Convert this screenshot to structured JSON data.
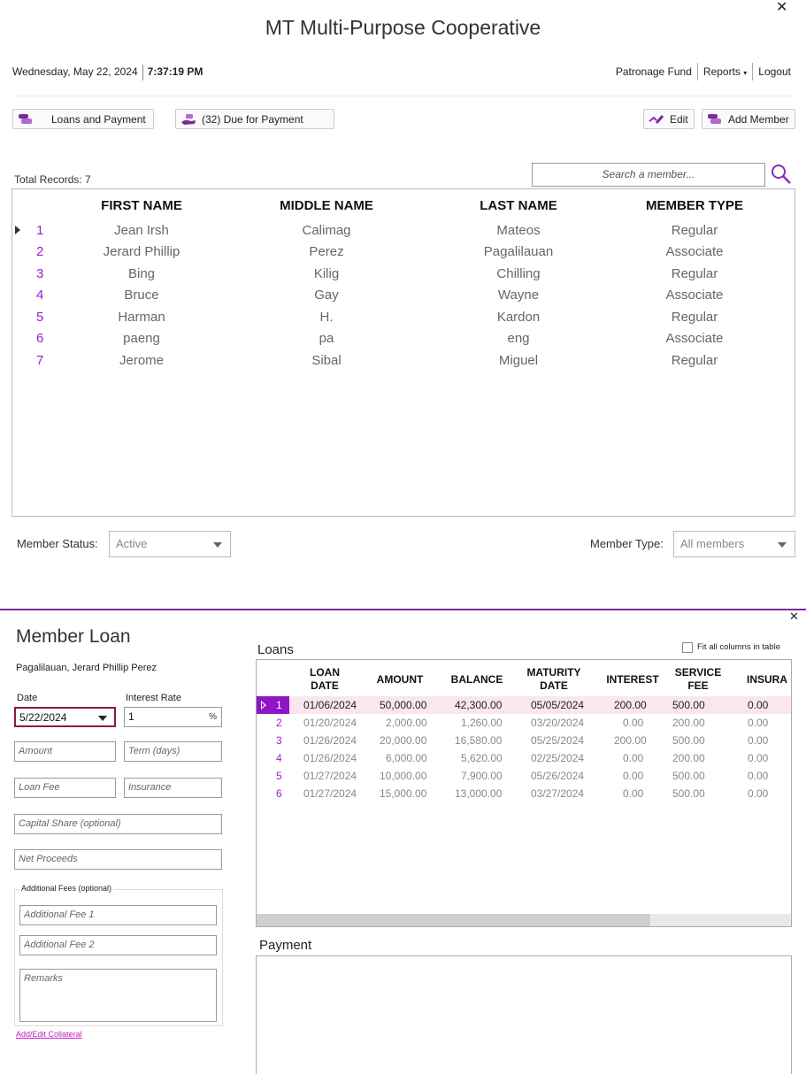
{
  "top_window": {
    "close_icon": "close-icon",
    "title": "MT Multi-Purpose Cooperative",
    "date": "Wednesday, May 22, 2024",
    "time": "7:37:19 PM",
    "nav": {
      "patronage": "Patronage Fund",
      "reports": "Reports",
      "logout": "Logout"
    },
    "toolbar": {
      "loans_payment": "Loans and Payment",
      "due_payment": "(32) Due for Payment",
      "edit": "Edit",
      "add_member": "Add Member"
    },
    "total_records": "Total Records: 7",
    "search_placeholder": "Search a member...",
    "columns": [
      "FIRST NAME",
      "MIDDLE NAME",
      "LAST NAME",
      "MEMBER TYPE"
    ],
    "rows": [
      {
        "num": "1",
        "first": "Jean Irsh",
        "middle": "Calimag",
        "last": "Mateos",
        "type": "Regular"
      },
      {
        "num": "2",
        "first": "Jerard Phillip",
        "middle": "Perez",
        "last": "Pagalilauan",
        "type": "Associate"
      },
      {
        "num": "3",
        "first": "Bing",
        "middle": "Kilig",
        "last": "Chilling",
        "type": "Regular"
      },
      {
        "num": "4",
        "first": "Bruce",
        "middle": "Gay",
        "last": "Wayne",
        "type": "Associate"
      },
      {
        "num": "5",
        "first": "Harman",
        "middle": "H.",
        "last": "Kardon",
        "type": "Regular"
      },
      {
        "num": "6",
        "first": "paeng",
        "middle": "pa",
        "last": "eng",
        "type": "Associate"
      },
      {
        "num": "7",
        "first": "Jerome",
        "middle": "Sibal",
        "last": "Miguel",
        "type": "Regular"
      }
    ],
    "member_status_label": "Member Status:",
    "member_status_value": "Active",
    "member_type_label": "Member Type:",
    "member_type_value": "All members"
  },
  "bottom_window": {
    "title": "Member Loan",
    "member_name": "Pagalilauan, Jerard Phillip Perez",
    "date_label": "Date",
    "date_value": "5/22/2024",
    "interest_label": "Interest Rate",
    "interest_value": "1",
    "percent": "%",
    "amount_ph": "Amount",
    "term_ph": "Term (days)",
    "loan_fee_ph": "Loan Fee",
    "insurance_ph": "Insurance",
    "capital_share_ph": "Capital Share (optional)",
    "net_proceeds_ph": "Net Proceeds",
    "additional_fees_label": "Additional Fees (optional)",
    "fee1_ph": "Additional Fee 1",
    "fee2_ph": "Additional Fee 2",
    "remarks_ph": "Remarks",
    "collateral_link": "Add/Edit Collateral",
    "loans_label": "Loans",
    "fit_columns": "Fit all columns in table",
    "loan_headers": [
      {
        "l1": "LOAN",
        "l2": "DATE"
      },
      {
        "l1": "AMOUNT",
        "l2": ""
      },
      {
        "l1": "BALANCE",
        "l2": ""
      },
      {
        "l1": "MATURITY",
        "l2": "DATE"
      },
      {
        "l1": "INTEREST",
        "l2": ""
      },
      {
        "l1": "SERVICE",
        "l2": "FEE"
      },
      {
        "l1": "INSURA",
        "l2": ""
      }
    ],
    "loans": [
      {
        "num": "1",
        "date": "01/06/2024",
        "amount": "50,000.00",
        "balance": "42,300.00",
        "maturity": "05/05/2024",
        "interest": "200.00",
        "service": "500.00",
        "insurance": "0.00"
      },
      {
        "num": "2",
        "date": "01/20/2024",
        "amount": "2,000.00",
        "balance": "1,260.00",
        "maturity": "03/20/2024",
        "interest": "0.00",
        "service": "200.00",
        "insurance": "0.00"
      },
      {
        "num": "3",
        "date": "01/26/2024",
        "amount": "20,000.00",
        "balance": "16,580.00",
        "maturity": "05/25/2024",
        "interest": "200.00",
        "service": "500.00",
        "insurance": "0.00"
      },
      {
        "num": "4",
        "date": "01/26/2024",
        "amount": "6,000.00",
        "balance": "5,620.00",
        "maturity": "02/25/2024",
        "interest": "0.00",
        "service": "200.00",
        "insurance": "0.00"
      },
      {
        "num": "5",
        "date": "01/27/2024",
        "amount": "10,000.00",
        "balance": "7,900.00",
        "maturity": "05/26/2024",
        "interest": "0.00",
        "service": "500.00",
        "insurance": "0.00"
      },
      {
        "num": "6",
        "date": "01/27/2024",
        "amount": "15,000.00",
        "balance": "13,000.00",
        "maturity": "03/27/2024",
        "interest": "0.00",
        "service": "500.00",
        "insurance": "0.00"
      }
    ],
    "payment_label": "Payment"
  },
  "colors": {
    "accent": "#9b1fcf",
    "selected_marker": "#8e16c4",
    "selected_row": "#f9e6ef",
    "divider": "#7a2a9a"
  }
}
